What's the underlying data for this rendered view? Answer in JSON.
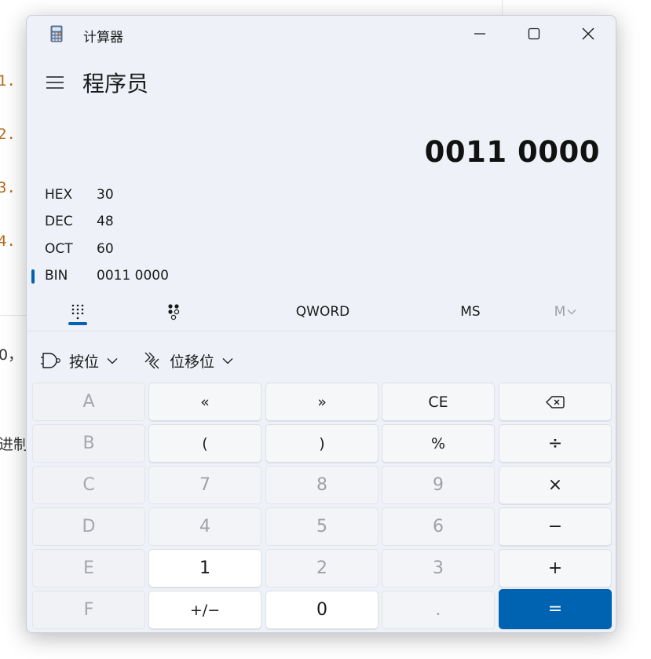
{
  "background": {
    "list_numbers": [
      "1.",
      "2.",
      "3.",
      "4."
    ],
    "text_fragments": [
      "0，",
      "进制"
    ]
  },
  "window": {
    "title": "计算器",
    "mode": "程序员"
  },
  "display": {
    "value": "0011 0000"
  },
  "radix": [
    {
      "name": "HEX",
      "value": "30"
    },
    {
      "name": "DEC",
      "value": "48"
    },
    {
      "name": "OCT",
      "value": "60"
    },
    {
      "name": "BIN",
      "value": "0011 0000"
    }
  ],
  "toolbar": {
    "word_size": "QWORD",
    "memory_store": "MS",
    "memory_menu": "M"
  },
  "ops": {
    "bitwise": "按位",
    "bitshift": "位移位"
  },
  "keys": [
    [
      "A",
      "«",
      "»",
      "CE",
      "⌫"
    ],
    [
      "B",
      "(",
      ")",
      "%",
      "÷"
    ],
    [
      "C",
      "7",
      "8",
      "9",
      "×"
    ],
    [
      "D",
      "4",
      "5",
      "6",
      "−"
    ],
    [
      "E",
      "1",
      "2",
      "3",
      "+"
    ],
    [
      "F",
      "+/−",
      "0",
      ".",
      "="
    ]
  ],
  "colors": {
    "accent": "#0063b1",
    "window_bg": "#eef2f8"
  }
}
